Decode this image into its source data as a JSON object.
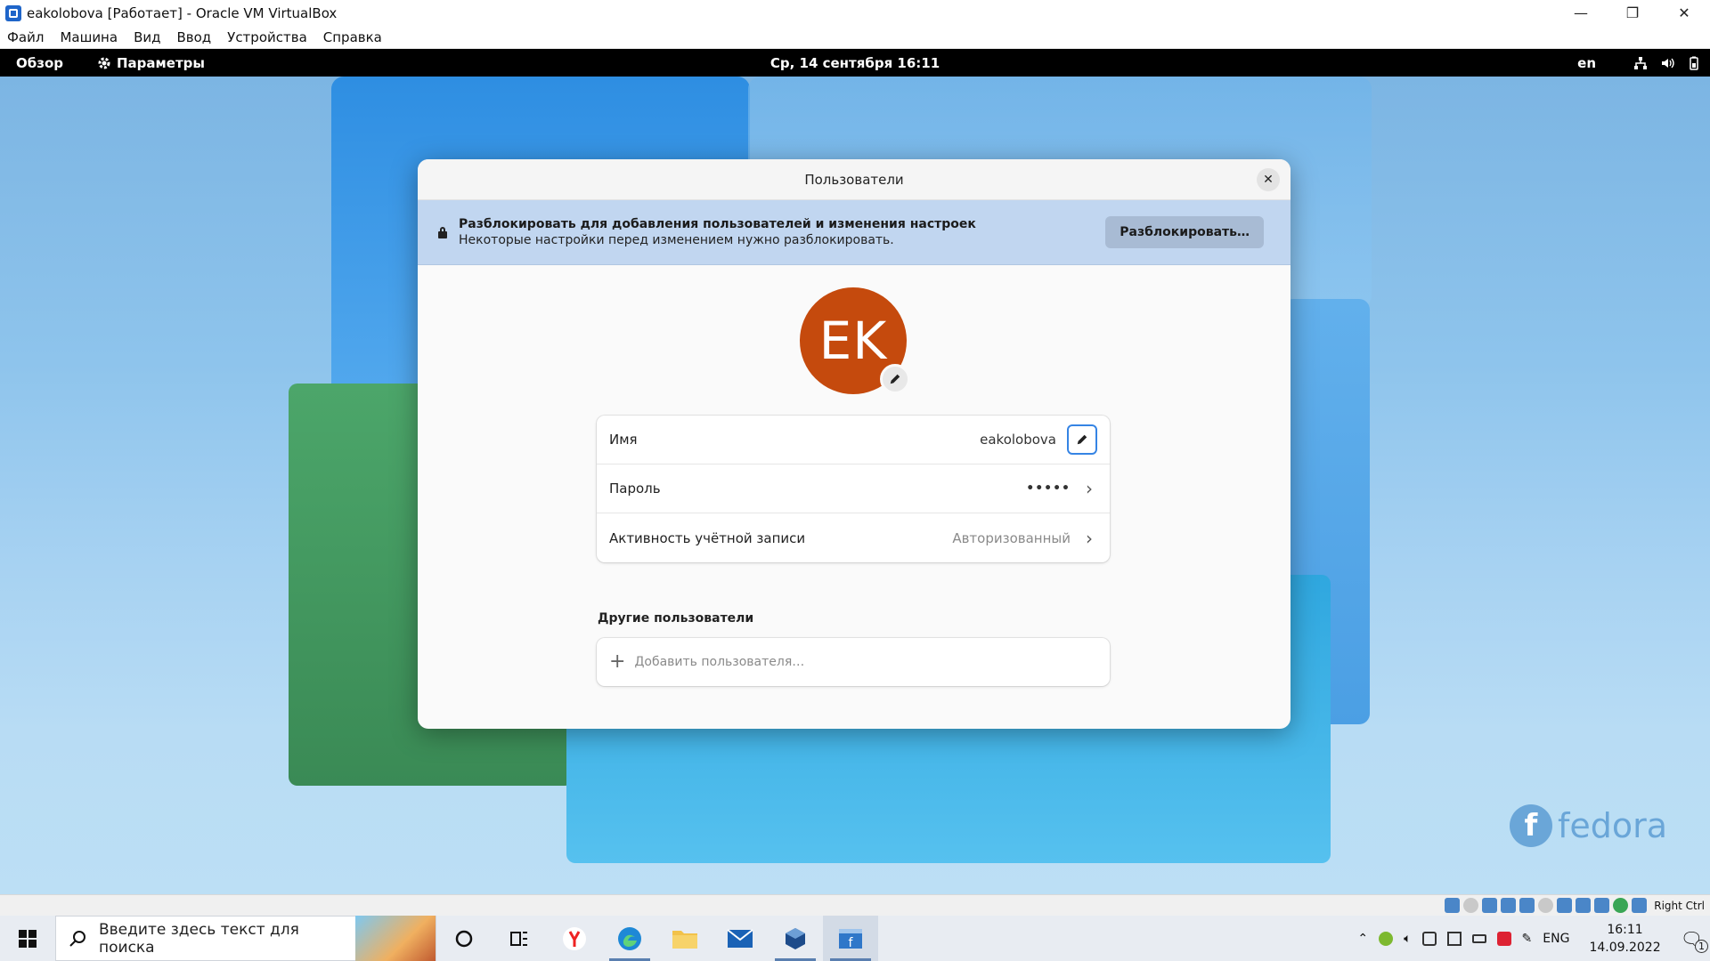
{
  "vbox": {
    "title": "eakolobova [Работает] - Oracle VM VirtualBox",
    "menu": [
      "Файл",
      "Машина",
      "Вид",
      "Ввод",
      "Устройства",
      "Справка"
    ],
    "window_buttons": [
      "—",
      "❐",
      "✕"
    ],
    "status_right_ctrl": "Right Ctrl"
  },
  "gnome": {
    "overview": "Обзор",
    "settings": "Параметры",
    "clock": "Ср, 14 сентября  16:11",
    "lang": "en"
  },
  "dialog": {
    "title": "Пользователи",
    "banner_title": "Разблокировать для добавления пользователей и изменения настроек",
    "banner_subtitle": "Некоторые настройки перед изменением нужно разблокировать.",
    "unlock_button": "Разблокировать…",
    "avatar_initials": "EK",
    "rows": [
      {
        "label": "Имя",
        "value": "eakolobova"
      },
      {
        "label": "Пароль",
        "value": "•••••"
      },
      {
        "label": "Активность учётной записи",
        "value": "Авторизованный"
      }
    ],
    "other_users_title": "Другие пользователи",
    "add_user": "Добавить пользователя…"
  },
  "desktop": {
    "logo_text": "fedora"
  },
  "taskbar": {
    "search_placeholder": "Введите здесь текст для поиска",
    "lang": "ENG",
    "time": "16:11",
    "date": "14.09.2022",
    "notifications": "1"
  },
  "colors": {
    "avatar": "#c54a0d",
    "banner": "#c1d6f0",
    "accent": "#3584e4"
  }
}
